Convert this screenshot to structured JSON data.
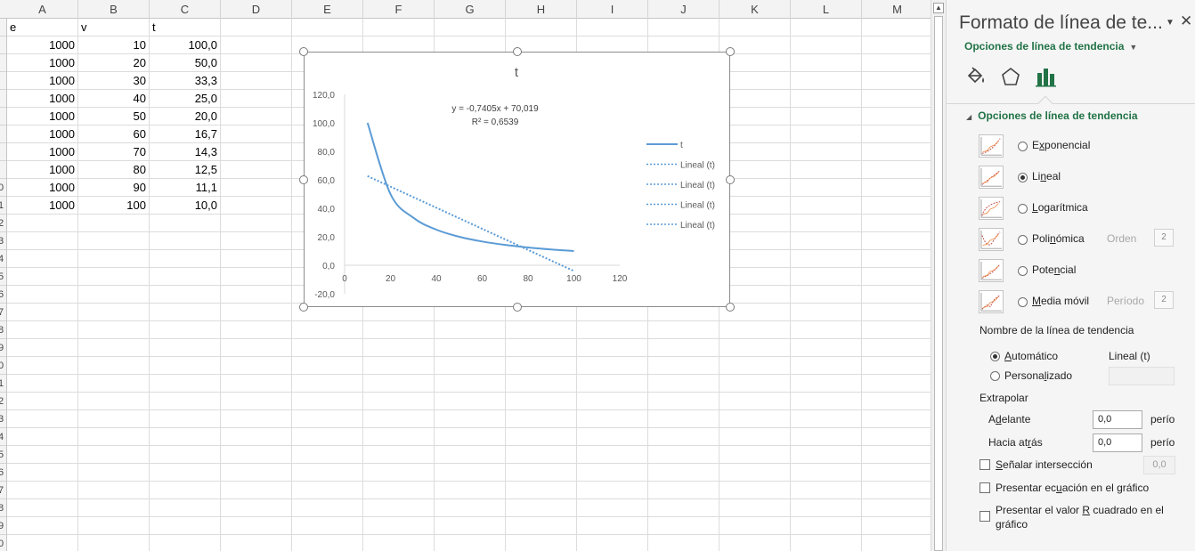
{
  "sheet": {
    "columns": [
      "A",
      "B",
      "C",
      "D",
      "E",
      "F",
      "G",
      "H",
      "I",
      "J",
      "K",
      "L",
      "M"
    ],
    "row_header_fragments": [
      "",
      "",
      "",
      "",
      "",
      "",
      "",
      "",
      "",
      "0",
      "1",
      "2",
      "3",
      "4",
      "5",
      "6",
      "7",
      "8",
      "9",
      "0",
      "1",
      "2",
      "3",
      "4",
      "5",
      "6",
      "7",
      "8",
      "9",
      "0"
    ],
    "header_row": {
      "a": "e",
      "b": "v",
      "c": "t"
    },
    "rows": [
      {
        "a": "1000",
        "b": "10",
        "c": "100,0"
      },
      {
        "a": "1000",
        "b": "20",
        "c": "50,0"
      },
      {
        "a": "1000",
        "b": "30",
        "c": "33,3"
      },
      {
        "a": "1000",
        "b": "40",
        "c": "25,0"
      },
      {
        "a": "1000",
        "b": "50",
        "c": "20,0"
      },
      {
        "a": "1000",
        "b": "60",
        "c": "16,7"
      },
      {
        "a": "1000",
        "b": "70",
        "c": "14,3"
      },
      {
        "a": "1000",
        "b": "80",
        "c": "12,5"
      },
      {
        "a": "1000",
        "b": "90",
        "c": "11,1"
      },
      {
        "a": "1000",
        "b": "100",
        "c": "10,0"
      }
    ]
  },
  "scrollbar": {
    "up_arrow": "▲"
  },
  "chart_data": {
    "type": "scatter",
    "title": "t",
    "x": [
      10,
      20,
      30,
      40,
      50,
      60,
      70,
      80,
      90,
      100
    ],
    "series": [
      {
        "name": "t",
        "values": [
          100.0,
          50.0,
          33.3,
          25.0,
          20.0,
          16.7,
          14.3,
          12.5,
          11.1,
          10.0
        ],
        "style": "smooth-line",
        "color": "#5b9bd5"
      }
    ],
    "trendline": {
      "type": "linear",
      "slope": -0.7405,
      "intercept": 70.019,
      "x_range": [
        10,
        100
      ],
      "style": "dotted",
      "color": "#5b9bd5"
    },
    "equation_label": "y = -0,7405x + 70,019",
    "r2_label": "R² = 0,6539",
    "xlim": [
      0,
      120
    ],
    "ylim": [
      -20,
      120
    ],
    "x_ticks": [
      "0",
      "20",
      "40",
      "60",
      "80",
      "100",
      "120"
    ],
    "y_ticks": [
      "120,0",
      "100,0",
      "80,0",
      "60,0",
      "40,0",
      "20,0",
      "0,0",
      "-20,0"
    ],
    "legend_position": "right",
    "legend": [
      "t",
      "Lineal (t)",
      "Lineal (t)",
      "Lineal (t)",
      "Lineal (t)"
    ],
    "grid": false
  },
  "pane": {
    "title": "Formato de línea de te...",
    "menu_icon": "chevron-down-icon",
    "close_glyph": "✕",
    "subtab": "Opciones de línea de tendencia",
    "section_title": "Opciones de línea de tendencia",
    "tab_icons": [
      "paint-bucket-icon",
      "pentagon-icon",
      "bar-chart-icon"
    ],
    "trend_types": [
      {
        "pre": "E",
        "ul": "x",
        "post": "ponencial",
        "selected": false
      },
      {
        "pre": "Li",
        "ul": "n",
        "post": "eal",
        "selected": true
      },
      {
        "pre": "",
        "ul": "L",
        "post": "ogarítmica",
        "selected": false
      },
      {
        "pre": "Poli",
        "ul": "n",
        "post": "ómica",
        "selected": false,
        "extra_label": "Orden",
        "extra_value": "2"
      },
      {
        "pre": "Pote",
        "ul": "n",
        "post": "cial",
        "selected": false
      },
      {
        "pre": "",
        "ul": "M",
        "post": "edia móvil",
        "selected": false,
        "extra_label": "Período",
        "extra_value": "2"
      }
    ],
    "name_heading": "Nombre de la línea de tendencia",
    "auto": {
      "pre": "",
      "ul": "A",
      "post": "utomático",
      "selected": true,
      "value": "Lineal (t)"
    },
    "custom": {
      "pre": "Persona",
      "ul": "l",
      "post": "izado",
      "selected": false
    },
    "extrapolate_heading": "Extrapolar",
    "forward": {
      "pre": "A",
      "ul": "d",
      "post": "elante",
      "value": "0,0",
      "unit": "perío"
    },
    "backward": {
      "pre": "Hacia at",
      "ul": "r",
      "post": "ás",
      "value": "0,0",
      "unit": "perío"
    },
    "intercept": {
      "pre": "",
      "ul": "S",
      "post": "eñalar intersección",
      "value": "0,0",
      "checked": false
    },
    "show_equation": {
      "pre": "Presentar ec",
      "ul": "u",
      "post": "ación en el gráfico",
      "checked": false
    },
    "show_r2": {
      "pre": "Presentar el valor ",
      "ul": "R",
      "post": " cuadrado en el",
      "line2": "gráfico",
      "checked": false
    }
  }
}
